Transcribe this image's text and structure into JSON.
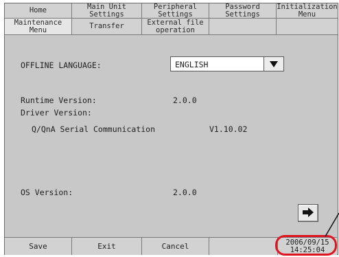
{
  "tabs_row1": [
    "Home",
    "Main Unit\nSettings",
    "Peripheral\nSettings",
    "Password\nSettings",
    "Initialization\nMenu"
  ],
  "tabs_row2": [
    "Maintenance\nMenu",
    "Transfer",
    "External file\noperation",
    "",
    ""
  ],
  "offline_language": {
    "label": "OFFLINE LANGUAGE:",
    "value": "ENGLISH"
  },
  "runtime": {
    "label": "Runtime Version:",
    "value": "2.0.0"
  },
  "driver": {
    "label": "Driver Version:",
    "name": "Q/QnA Serial Communication",
    "value": "V1.10.02"
  },
  "os": {
    "label": "OS Version:",
    "value": "2.0.0"
  },
  "buttons": {
    "save": "Save",
    "exit": "Exit",
    "cancel": "Cancel"
  },
  "clock": {
    "date": "2006/09/15",
    "time": "14:25:04"
  },
  "colors": {
    "highlight": "#e0141e",
    "panel": "#c8c8c8"
  },
  "icons": {
    "dropdown": "triangle-down-icon",
    "next": "arrow-right-icon"
  }
}
